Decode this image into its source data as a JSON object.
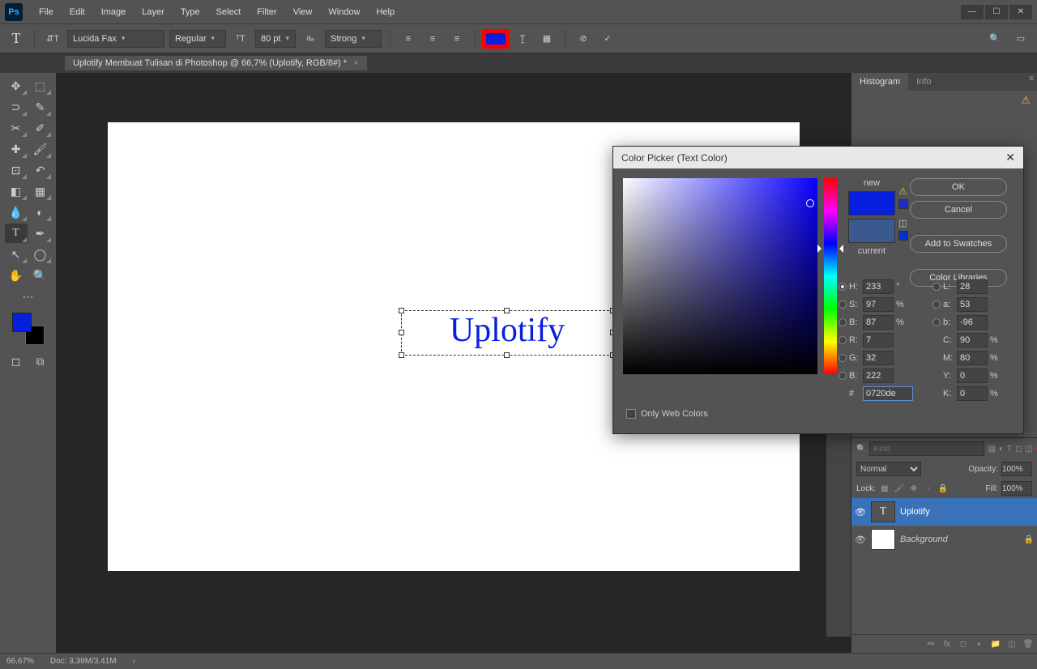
{
  "menubar": {
    "items": [
      "File",
      "Edit",
      "Image",
      "Layer",
      "Type",
      "Select",
      "Filter",
      "View",
      "Window",
      "Help"
    ]
  },
  "optionsbar": {
    "font": "Lucida Fax",
    "fontStyle": "Regular",
    "fontSize": "80 pt",
    "aa": "Strong"
  },
  "docTab": "Uplotify Membuat Tulisan di Photoshop @ 66,7% (Uplotify, RGB/8#) *",
  "canvas": {
    "text": "Uplotify"
  },
  "panels": {
    "tab1": "Histogram",
    "tab2": "Info",
    "layersFilterPh": "Kind",
    "blend": "Normal",
    "opacityLbl": "Opacity:",
    "opacityVal": "100%",
    "lockLbl": "Lock:",
    "fillLbl": "Fill:",
    "fillVal": "100%",
    "layer1": "Uplotify",
    "layer2": "Background"
  },
  "colorPicker": {
    "title": "Color Picker (Text Color)",
    "new": "new",
    "current": "current",
    "ok": "OK",
    "cancel": "Cancel",
    "addSwatches": "Add to Swatches",
    "libraries": "Color Libraries",
    "H": "233",
    "S": "97",
    "Bv": "87",
    "R": "7",
    "G": "32",
    "Bb": "222",
    "L": "28",
    "a": "53",
    "b": "-96",
    "C": "90",
    "M": "80",
    "Y": "0",
    "K": "0",
    "hex": "0720de",
    "webOnly": "Only Web Colors",
    "newColor": "#0720de",
    "currentColor": "#3a5a8f"
  },
  "status": {
    "zoom": "66,67%",
    "doc": "Doc: 3,39M/3,41M"
  }
}
